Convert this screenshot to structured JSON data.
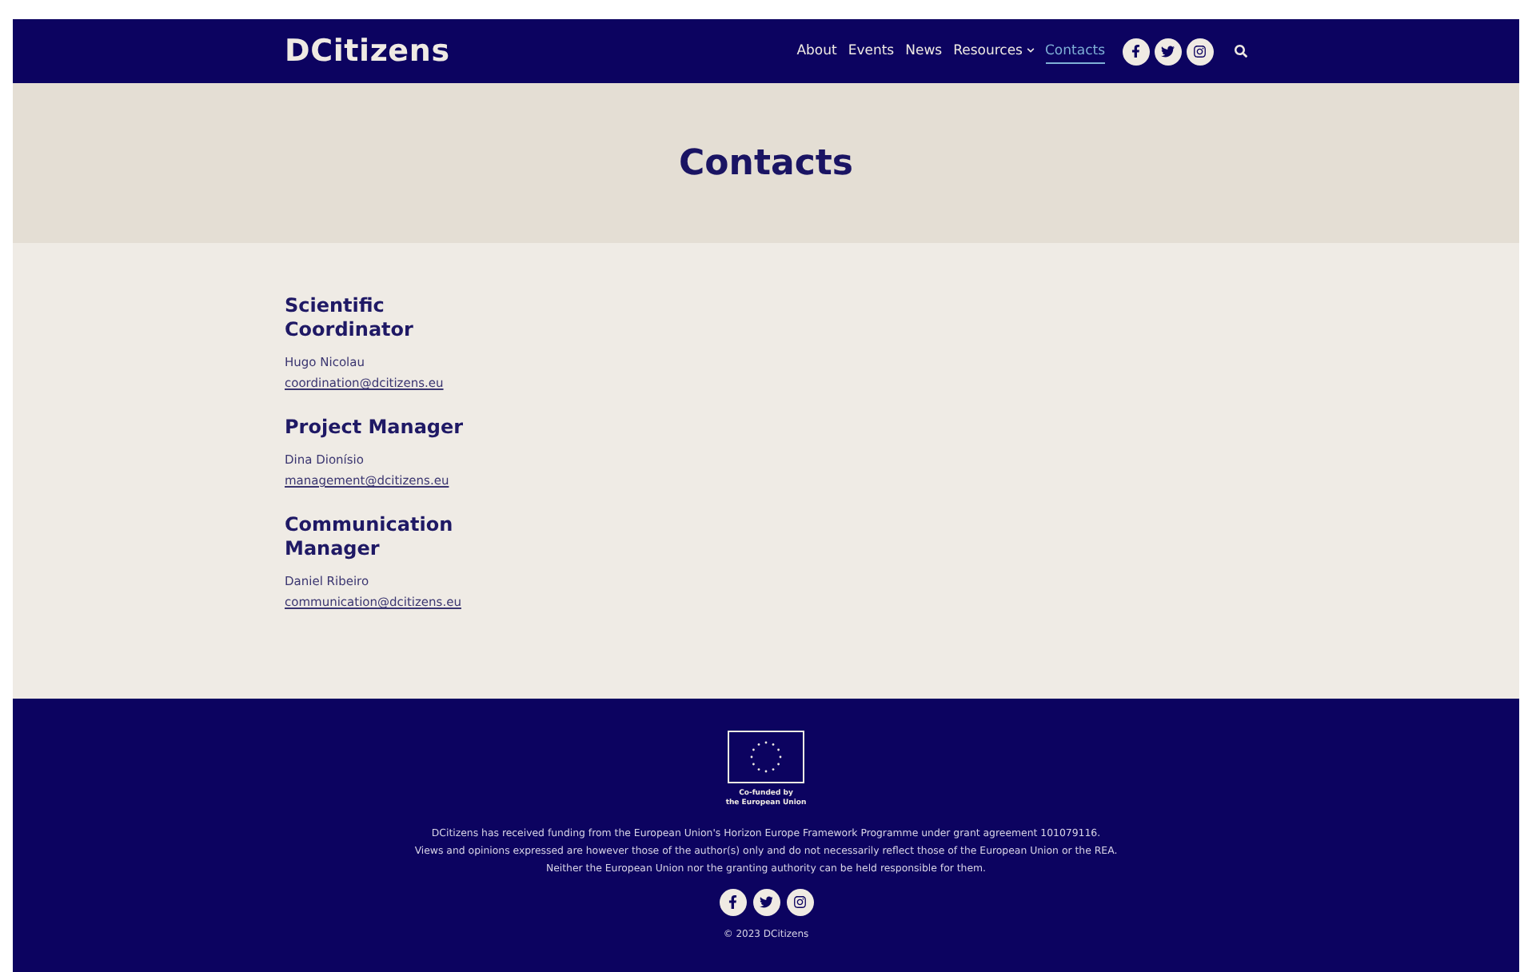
{
  "header": {
    "logo": "DCitizens",
    "nav": [
      {
        "label": "About",
        "kind": "link",
        "selected": false
      },
      {
        "label": "Events",
        "kind": "link",
        "selected": false
      },
      {
        "label": "News",
        "kind": "link",
        "selected": false
      },
      {
        "label": "Resources",
        "kind": "dropdown",
        "selected": false
      },
      {
        "label": "Contacts",
        "kind": "link",
        "selected": true
      }
    ],
    "social": [
      {
        "kind": "facebook"
      },
      {
        "kind": "twitter"
      },
      {
        "kind": "instagram"
      }
    ]
  },
  "hero": {
    "title": "Contacts"
  },
  "contacts": [
    {
      "role": "Scientific Coordinator",
      "name": "Hugo Nicolau",
      "email": "coordination@dcitizens.eu"
    },
    {
      "role": "Project Manager",
      "name": "Dina Dionísio",
      "email": "management@dcitizens.eu"
    },
    {
      "role": "Communication Manager",
      "name": "Daniel Ribeiro",
      "email": "communication@dcitizens.eu"
    }
  ],
  "footer": {
    "eu_caption": [
      "Co-funded by",
      "the European Union"
    ],
    "disclaimer": [
      "DCitizens has received funding from the European Union's Horizon Europe Framework Programme under grant agreement 101079116.",
      "Views and opinions expressed are however those of the author(s) only and do not necessarily reflect those of the European Union or the REA.",
      "Neither the European Union nor the granting authority can be held responsible for them."
    ],
    "social": [
      {
        "kind": "facebook"
      },
      {
        "kind": "twitter"
      },
      {
        "kind": "instagram"
      }
    ],
    "copyright": "© 2023 DCitizens"
  }
}
